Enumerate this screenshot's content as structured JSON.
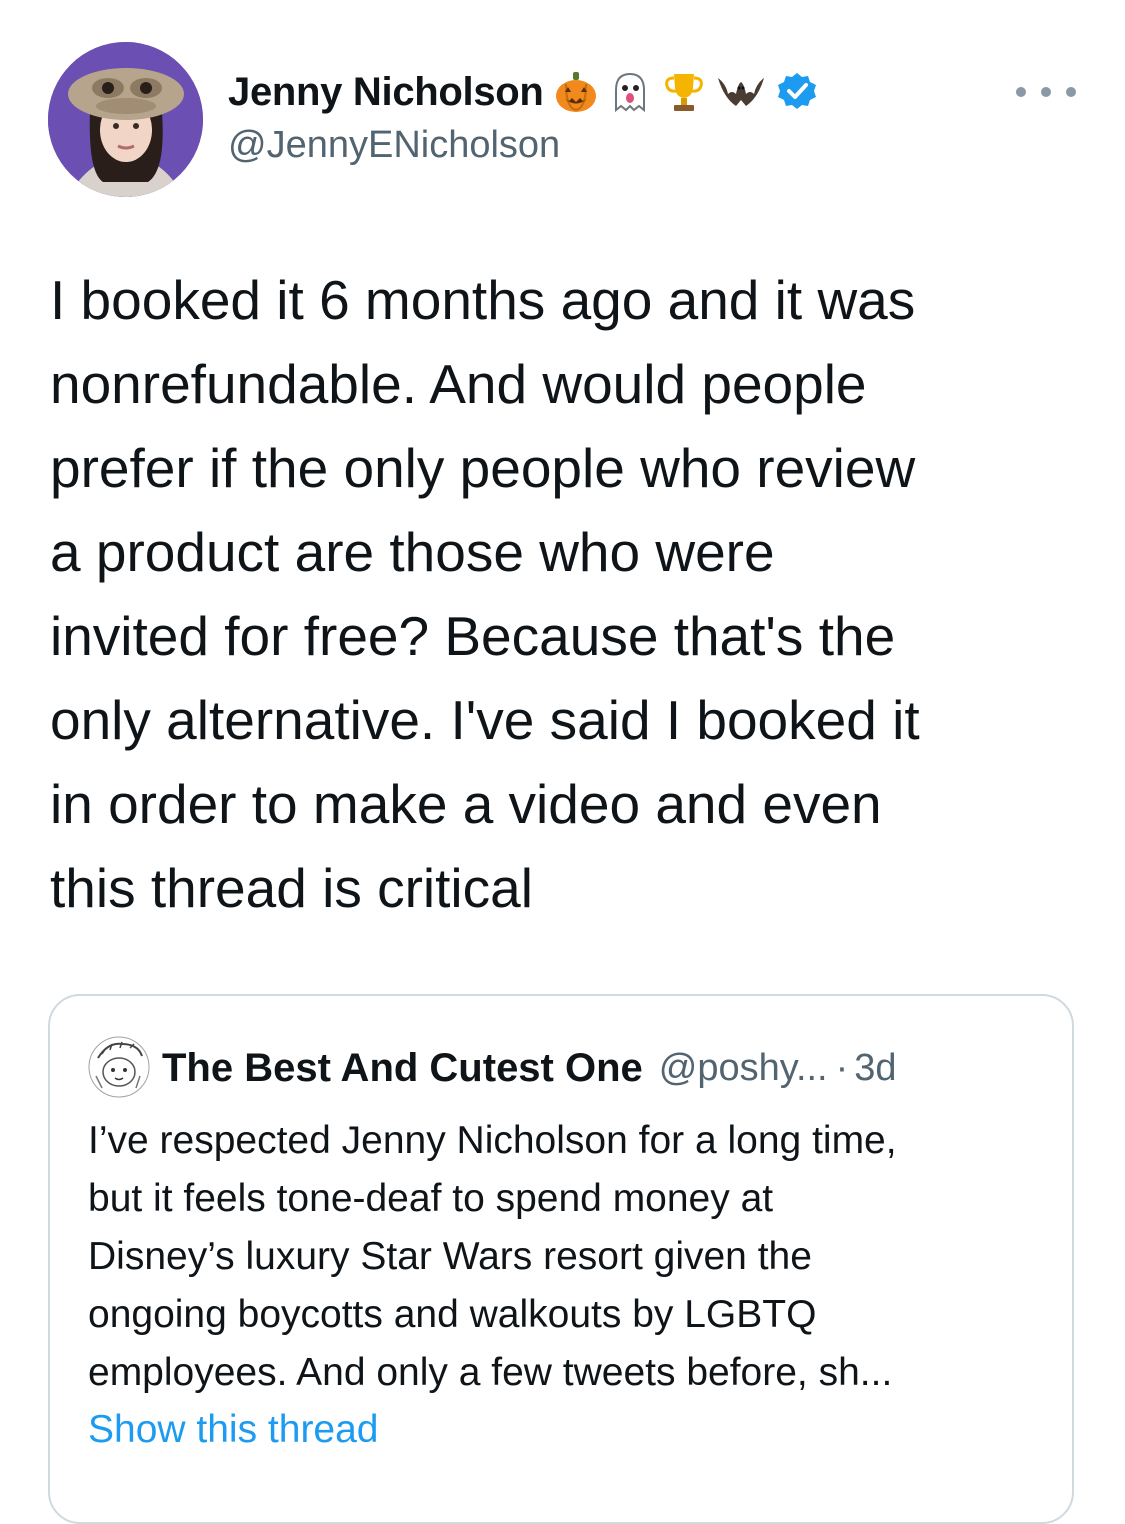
{
  "author": {
    "display_name": "Jenny Nicholson",
    "handle": "@JennyENicholson",
    "name_emojis": [
      "jack-o-lantern-icon",
      "ghost-icon",
      "trophy-icon",
      "bat-icon"
    ],
    "verified": true
  },
  "tweet": {
    "text": "I booked it 6 months ago and it was\nnonrefundable. And would people\nprefer if the only people who review\na product are those who were\ninvited for free? Because that's the\nonly alternative. I've said I booked it\nin order to make a video and even\nthis thread is critical"
  },
  "quoted_tweet": {
    "display_name": "The Best And Cutest One",
    "handle": "@poshy...",
    "separator": "·",
    "time": "3d",
    "text": "I’ve respected Jenny Nicholson for a long time,\nbut it feels tone-deaf to spend money at\nDisney’s luxury Star Wars resort given the\nongoing boycotts and walkouts by LGBTQ\nemployees. And only a few tweets before, sh...",
    "show_thread_label": "Show this thread"
  },
  "colors": {
    "text_primary": "#0f1419",
    "text_secondary": "#536471",
    "link": "#1d9bf0",
    "verified": "#1d9bf0",
    "border": "#cfd9de"
  }
}
